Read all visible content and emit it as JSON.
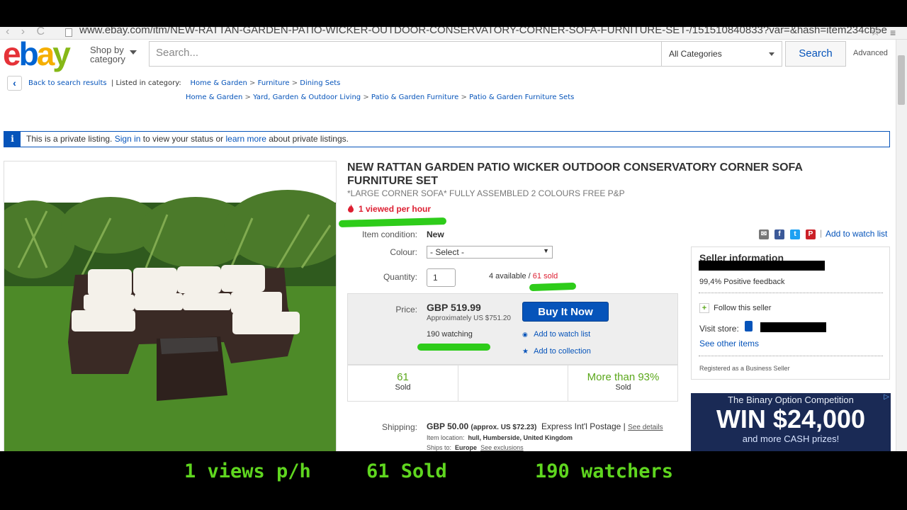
{
  "browser": {
    "url": "www.ebay.com/itm/NEW-RATTAN-GARDEN-PATIO-WICKER-OUTDOOR-CONSERVATORY-CORNER-SOFA-FURNITURE-SET-/151510840833?var=&hash=item234cb5e",
    "nav_glyphs": "‹ › C",
    "star": "☆",
    "menu": "≡"
  },
  "header": {
    "logo_letters": [
      "e",
      "b",
      "a",
      "y"
    ],
    "shop_by_line1": "Shop by",
    "shop_by_line2": "category",
    "search_placeholder": "Search...",
    "category": "All Categories",
    "search_button": "Search",
    "advanced": "Advanced"
  },
  "breadcrumb": {
    "back": "Back to search results",
    "listed_in": "| Listed in category:",
    "path1": [
      "Home & Garden",
      "Furniture",
      "Dining Sets"
    ],
    "path2": [
      "Home & Garden",
      "Yard, Garden & Outdoor Living",
      "Patio & Garden Furniture",
      "Patio & Garden Furniture Sets"
    ],
    "sep": ">"
  },
  "notice": {
    "icon": "i",
    "text1": "This is a private listing.",
    "sign_in": "Sign in",
    "text2": "to view your status or",
    "learn_more": "learn more",
    "text3": "about private listings."
  },
  "item": {
    "title": "NEW RATTAN GARDEN PATIO WICKER OUTDOOR CONSERVATORY CORNER SOFA FURNITURE SET",
    "subtitle": "*LARGE CORNER SOFA* FULLY ASSEMBLED 2 COLOURS FREE P&P",
    "viewed": "1 viewed per hour",
    "viewed_icon": "flame-icon",
    "condition_label": "Item condition:",
    "condition": "New",
    "colour_label": "Colour:",
    "colour_value": "- Select -",
    "quantity_label": "Quantity:",
    "quantity": "1",
    "available": "4 available /",
    "sold": "61 sold",
    "price_label": "Price:",
    "price": "GBP 519.99",
    "approx": "Approximately US $751.20",
    "watching": "190 watching",
    "buy_now": "Buy It Now",
    "add_watch": "Add to watch list",
    "add_collection": "Add to collection",
    "stats": [
      {
        "big": "61",
        "small": "Sold"
      },
      {
        "big": "More than 93%",
        "small": "Sold"
      }
    ],
    "shipping_label": "Shipping:",
    "shipping_price": "GBP 50.00",
    "shipping_approx": "(approx. US $72.23)",
    "shipping_method": "Express Int'l Postage |",
    "see_details": "See details",
    "item_location_label": "Item location:",
    "item_location": "hull, Humberside, United Kingdom",
    "ships_to_label": "Ships to:",
    "ships_to": "Europe",
    "see_exclusions": "See exclusions"
  },
  "share": {
    "watch_link": "Add to watch list",
    "icons": [
      "email-icon",
      "facebook-icon",
      "twitter-icon",
      "pinterest-icon"
    ],
    "colors": [
      "#777777",
      "#3b5998",
      "#1da1f2",
      "#cb2027"
    ],
    "glyphs": [
      "✉",
      "f",
      "t",
      "P"
    ],
    "divider": "|"
  },
  "seller": {
    "heading": "Seller information",
    "feedback": "99,4% Positive feedback",
    "follow_icon": "+",
    "follow": "Follow this seller",
    "visit_store": "Visit store:",
    "see_other": "See other items",
    "registered": "Registered as a Business Seller"
  },
  "ad": {
    "line1": "The Binary Option Competition",
    "line2": "WIN $24,000",
    "line3": "and more CASH prizes!",
    "badge": "▷"
  },
  "caption": {
    "views": "1 views p/h",
    "sold": "61 Sold",
    "watchers": "190 watchers"
  },
  "colors": {
    "ebay_blue": "#0654ba",
    "highlight_green": "#2ecc1a",
    "caption_green": "#5fd61f",
    "alert_red": "#dd1e31"
  }
}
